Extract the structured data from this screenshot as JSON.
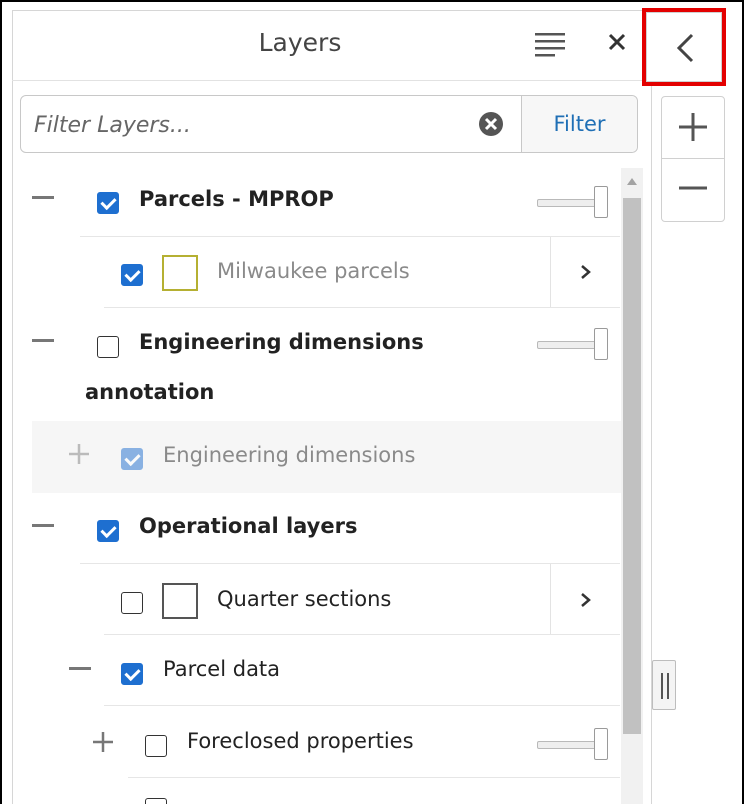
{
  "panel": {
    "title": "Layers",
    "menu_icon": "list-icon",
    "close_label": "×"
  },
  "filter": {
    "placeholder": "Filter Layers...",
    "clear_icon": "clear-circle-icon",
    "button_label": "Filter"
  },
  "layers": {
    "parcels_mprop": {
      "label": "Parcels - MPROP",
      "checked": true,
      "expanded": true
    },
    "milwaukee_parcels": {
      "label": "Milwaukee parcels",
      "checked": true,
      "swatch_color": "#b5b032"
    },
    "engineering_group": {
      "label_line1": "Engineering dimensions",
      "label_line2": "annotation",
      "checked": false,
      "expanded": true
    },
    "engineering_dimensions": {
      "label": "Engineering dimensions",
      "checked": true,
      "disabled": true
    },
    "operational_layers": {
      "label": "Operational layers",
      "checked": true,
      "expanded": true
    },
    "quarter_sections": {
      "label": "Quarter sections",
      "checked": false
    },
    "parcel_data": {
      "label": "Parcel data",
      "checked": true,
      "expanded": true
    },
    "foreclosed_properties": {
      "label": "Foreclosed properties",
      "checked": false,
      "expanded": false
    }
  },
  "controls": {
    "collapse_icon": "chevron-left-icon",
    "zoom_in_icon": "plus-icon",
    "zoom_out_icon": "minus-icon",
    "highlight_color": "#e30000",
    "checkbox_color": "#1e6fd0"
  }
}
